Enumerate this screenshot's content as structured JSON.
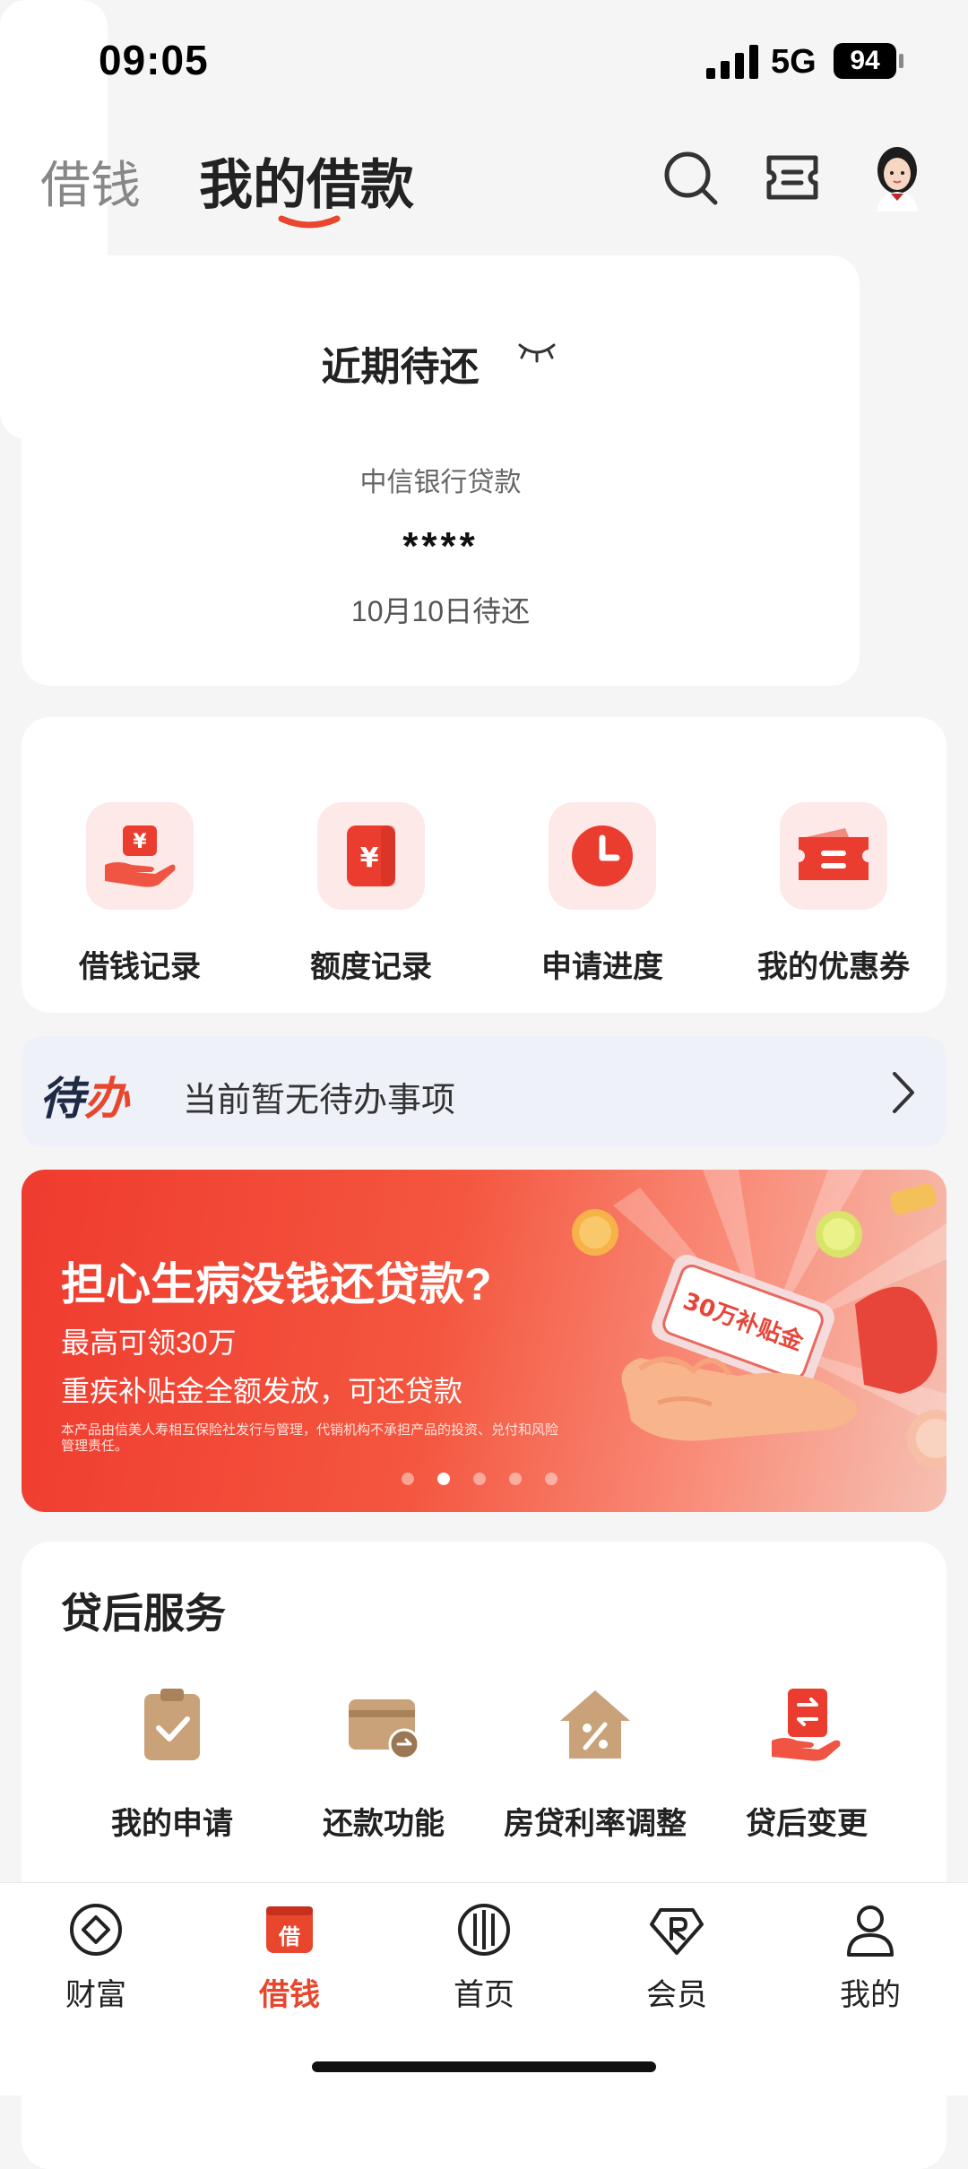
{
  "status_bar": {
    "time": "09:05",
    "network": "5G",
    "battery": "94"
  },
  "header": {
    "tab_borrow": "借钱",
    "tab_my_loans": "我的借款",
    "accent_color": "#e8462d"
  },
  "due_card": {
    "title": "近期待还",
    "bank": "中信银行贷款",
    "amount": "****",
    "due_date": "10月10日待还"
  },
  "quick_actions": [
    {
      "label": "借钱记录",
      "icon": "hand-yuan-icon"
    },
    {
      "label": "额度记录",
      "icon": "yuan-card-icon"
    },
    {
      "label": "申请进度",
      "icon": "clock-icon"
    },
    {
      "label": "我的优惠券",
      "icon": "coupon-icon"
    }
  ],
  "todo": {
    "logo_main": "待",
    "logo_accent": "办",
    "text": "当前暂无待办事项"
  },
  "banner": {
    "title": "担心生病没钱还贷款?",
    "subtitle1": "最高可领30万",
    "subtitle2": "重疾补贴金全额发放，可还贷款",
    "fine_print": "本产品由信美人寿相互保险社发行与管理，代销机构不承担产品的投资、兑付和风险管理责任。",
    "art_text": "30万补贴金",
    "pages": 5,
    "active_page": 2
  },
  "service": {
    "title": "贷后服务",
    "items": [
      {
        "label": "我的申请",
        "icon": "clipboard-check-icon"
      },
      {
        "label": "还款功能",
        "icon": "card-repay-icon"
      },
      {
        "label": "房贷利率调整",
        "icon": "house-percent-icon"
      },
      {
        "label": "贷后变更",
        "icon": "transfer-hand-icon"
      }
    ]
  },
  "bottom_nav": {
    "items": [
      {
        "label": "财富",
        "icon": "diamond-icon"
      },
      {
        "label": "借钱",
        "icon": "borrow-icon",
        "badge": "借",
        "active": true
      },
      {
        "label": "首页",
        "icon": "home-logo-icon"
      },
      {
        "label": "会员",
        "icon": "member-icon"
      },
      {
        "label": "我的",
        "icon": "person-icon"
      }
    ]
  }
}
